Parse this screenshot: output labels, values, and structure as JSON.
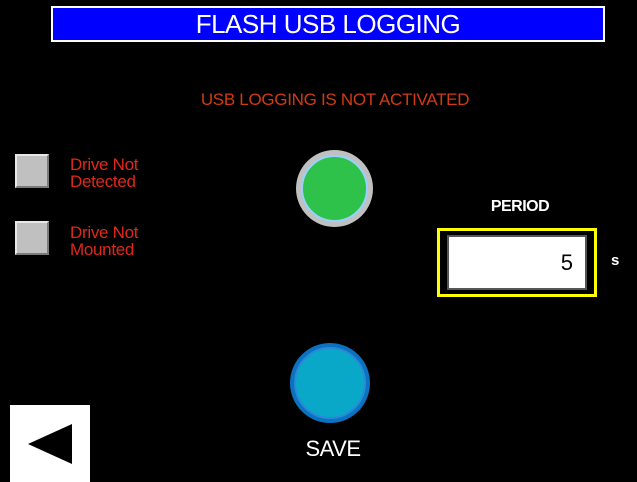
{
  "header": {
    "title": "FLASH USB LOGGING"
  },
  "status": {
    "message": "USB LOGGING IS NOT ACTIVATED",
    "color": "#d23a14"
  },
  "indicators": [
    {
      "line1": "Drive Not",
      "line2": "Detected"
    },
    {
      "line1": "Drive Not",
      "line2": "Mounted"
    }
  ],
  "buttons": {
    "activate_color": "#2ec24a",
    "activate_icon": "green-circle-button",
    "save_color": "#0aa8c8",
    "save_label": "SAVE",
    "back_icon": "left-triangle-icon"
  },
  "period": {
    "label": "PERIOD",
    "value": "5",
    "unit": "s",
    "border_color": "#ffff00"
  },
  "colors": {
    "background": "#000000",
    "title_bg": "#0000ff",
    "indicator_text": "#e0281a"
  }
}
